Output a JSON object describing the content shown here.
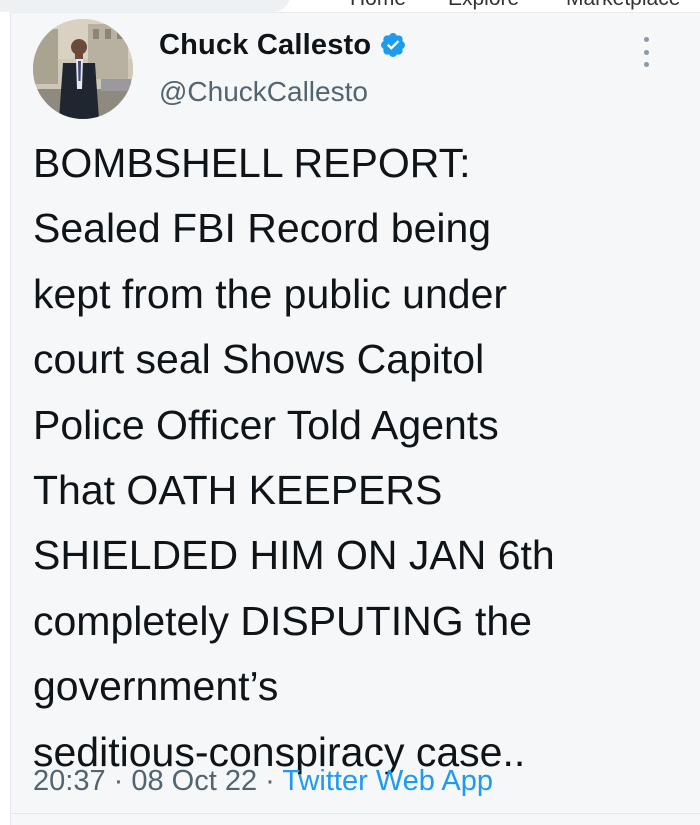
{
  "nav": {
    "items": [
      "Home",
      "Explore",
      "Marketplace"
    ]
  },
  "tweet": {
    "display_name": "Chuck Callesto",
    "handle": "@ChuckCallesto",
    "text": "BOMBSHELL REPORT:\nSealed FBI Record being\nkept from the public under\ncourt seal Shows Capitol\nPolice Officer Told Agents\nThat OATH KEEPERS\nSHIELDED HIM ON JAN 6th\ncompletely DISPUTING the\ngovernment’s\nseditious-conspiracy case..",
    "time": "20:37",
    "sep1": " · ",
    "date": "08 Oct 22",
    "sep2": " · ",
    "app": "Twitter Web App"
  },
  "colors": {
    "text": "#0f1419",
    "secondary": "#536471",
    "link": "#1d9bf0",
    "verified": "#1d9bf0",
    "card_bg": "#f5f7f9"
  },
  "icons": {
    "verified": "verified-badge-icon",
    "more": "more-vertical-icon"
  }
}
